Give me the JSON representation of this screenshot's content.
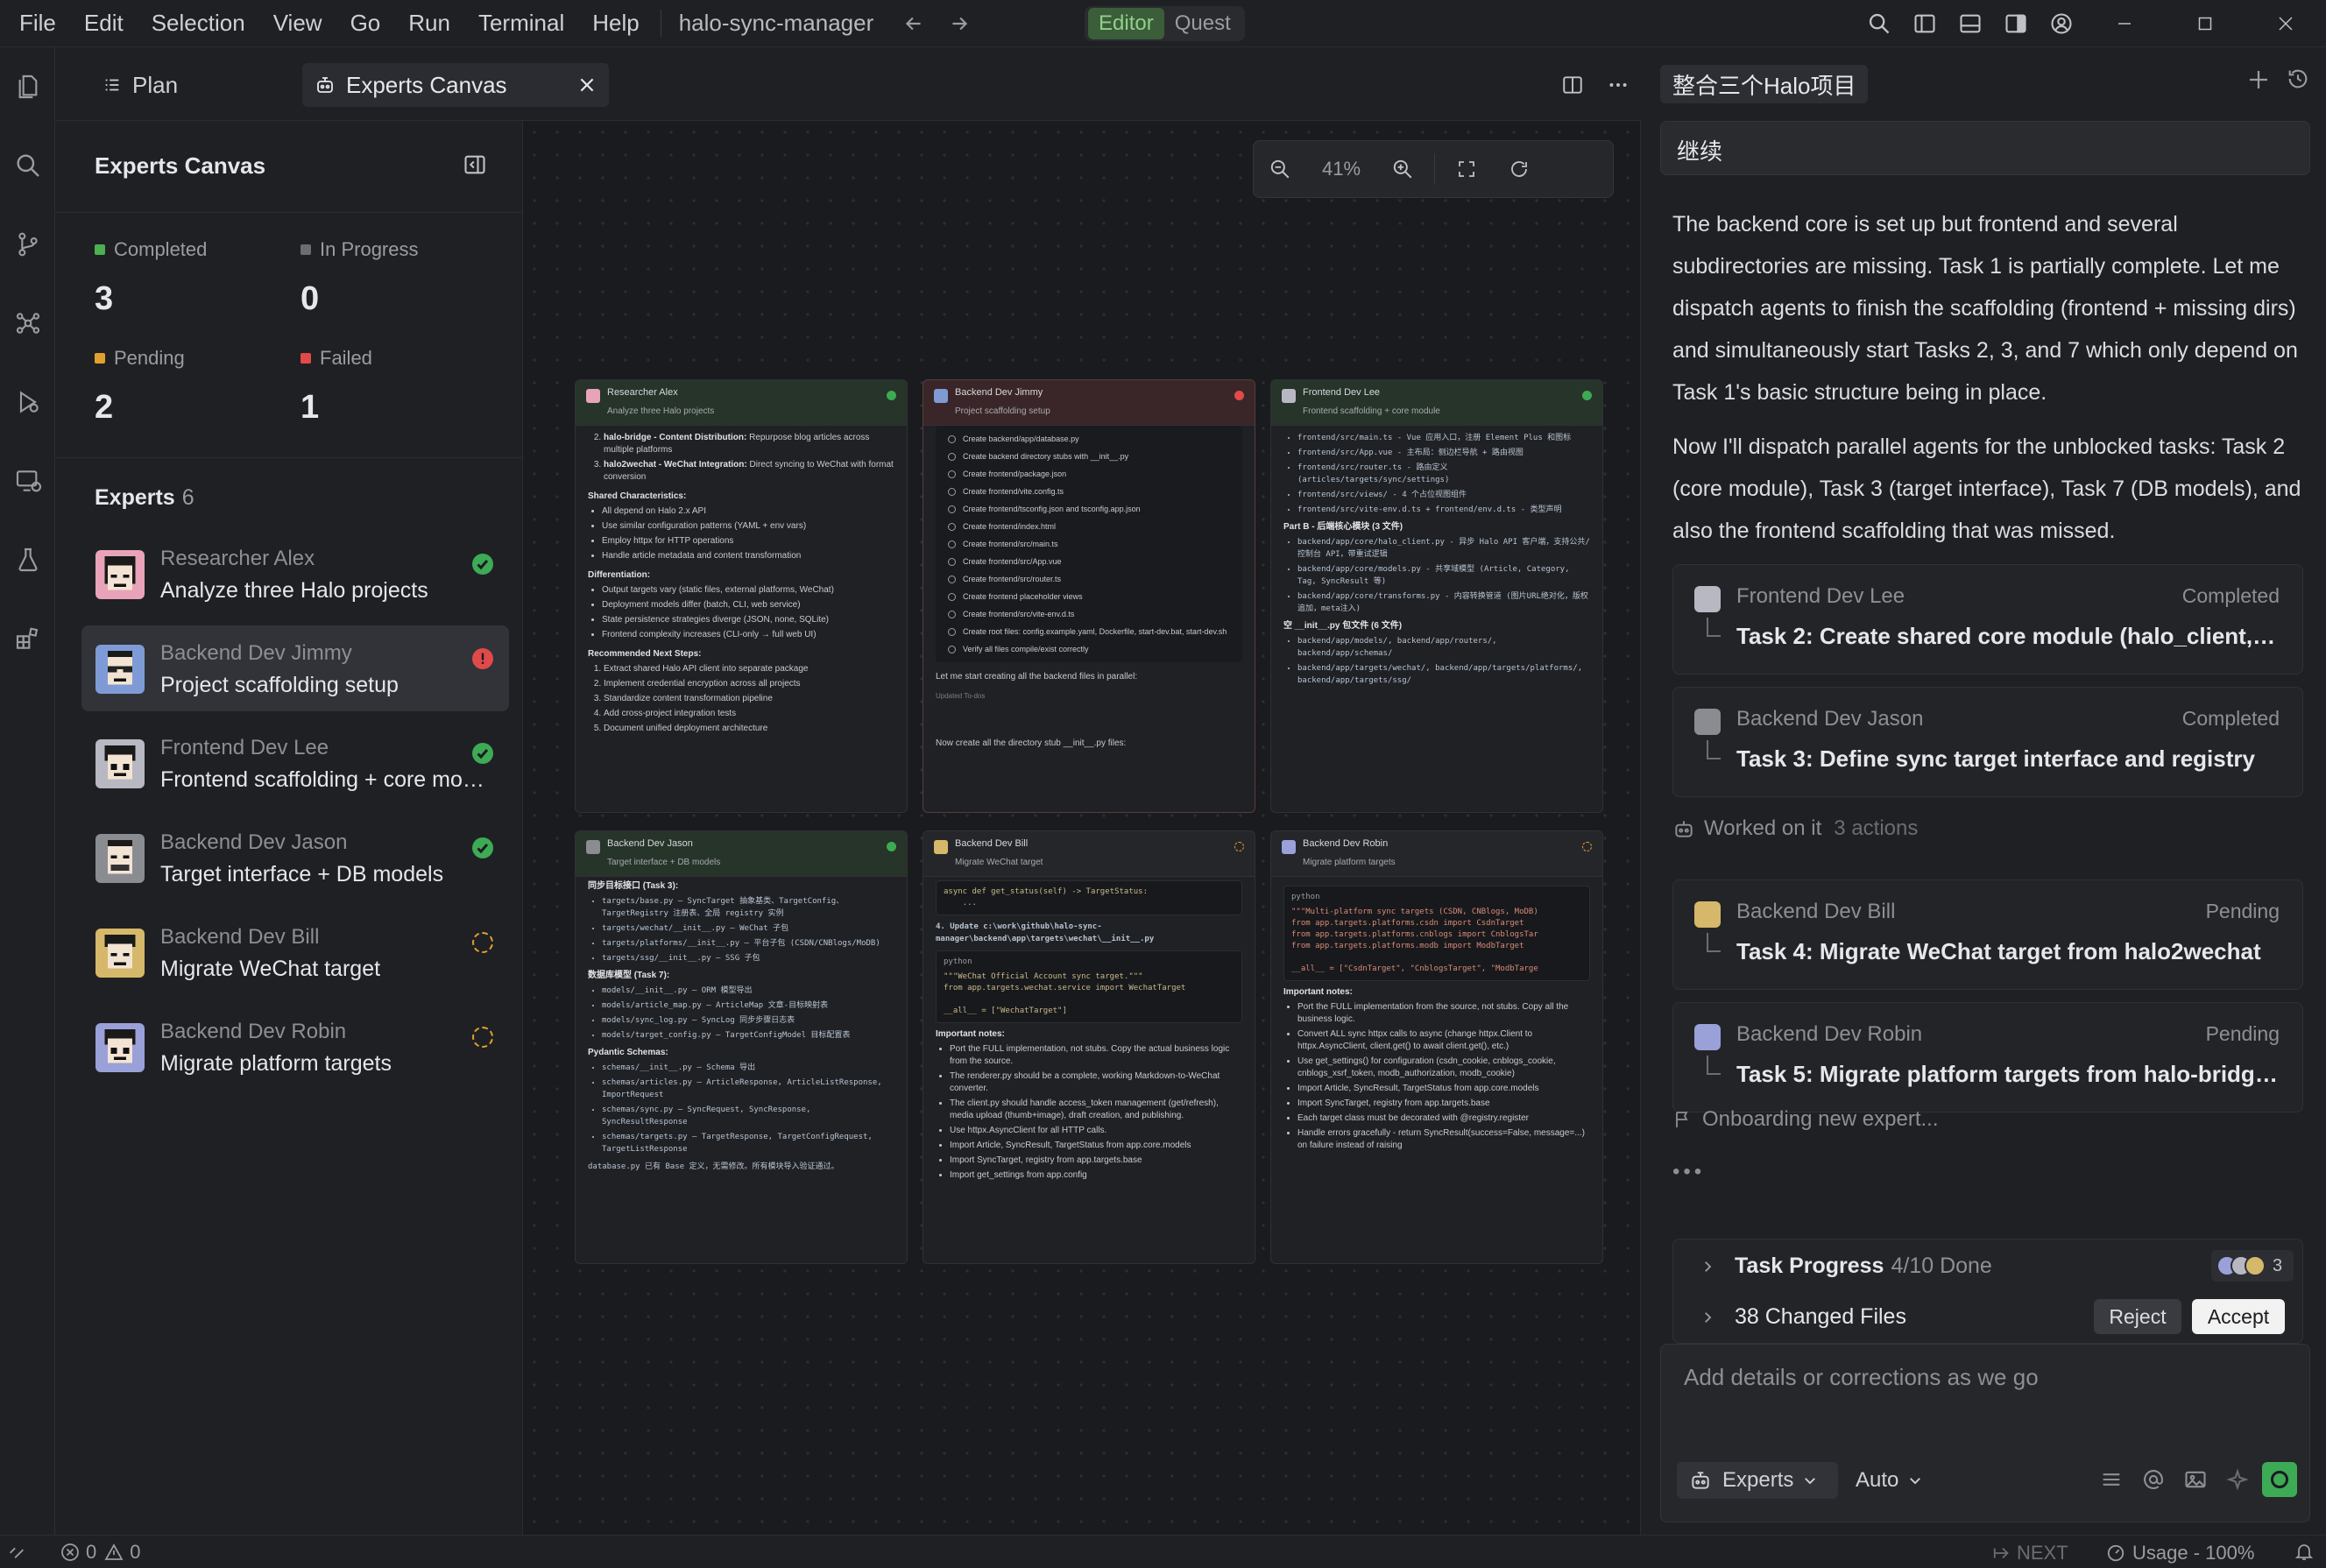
{
  "menu": [
    "File",
    "Edit",
    "Selection",
    "View",
    "Go",
    "Run",
    "Terminal",
    "Help"
  ],
  "project_name": "halo-sync-manager",
  "mode": {
    "active": "Editor",
    "inactive": "Quest"
  },
  "tabs": {
    "plan": "Plan",
    "canvas": "Experts Canvas"
  },
  "panel": {
    "title": "Experts Canvas",
    "stats": [
      {
        "label": "Completed",
        "value": "3",
        "color": "#4caf50"
      },
      {
        "label": "In Progress",
        "value": "0",
        "color": "#8d8f95"
      },
      {
        "label": "Pending",
        "value": "2",
        "color": "#e0a030"
      },
      {
        "label": "Failed",
        "value": "1",
        "color": "#e04a4a"
      }
    ],
    "experts_label": "Experts",
    "experts_count": "6",
    "experts": [
      {
        "name": "Researcher Alex",
        "task": "Analyze three Halo projects",
        "status": "completed"
      },
      {
        "name": "Backend Dev Jimmy",
        "task": "Project scaffolding setup",
        "status": "failed"
      },
      {
        "name": "Frontend Dev Lee",
        "task": "Frontend scaffolding + core modules",
        "status": "completed"
      },
      {
        "name": "Backend Dev Jason",
        "task": "Target interface + DB models",
        "status": "completed"
      },
      {
        "name": "Backend Dev Bill",
        "task": "Migrate WeChat target",
        "status": "pending"
      },
      {
        "name": "Backend Dev Robin",
        "task": "Migrate platform targets",
        "status": "pending"
      }
    ]
  },
  "zoom": "41%",
  "cards": {
    "alex": {
      "name": "Researcher Alex",
      "task": "Analyze three Halo projects",
      "items": [
        {
          "b": "halo-bridge - Content Distribution:",
          "t": " Repurpose blog articles across multiple platforms"
        },
        {
          "b": "halo2wechat - WeChat Integration:",
          "t": " Direct syncing to WeChat with format conversion"
        }
      ],
      "shared_title": "Shared Characteristics:",
      "shared": [
        "All depend on Halo 2.x API",
        "Use similar configuration patterns (YAML + env vars)",
        "Employ httpx for HTTP operations",
        "Handle article metadata and content transformation"
      ],
      "diff_title": "Differentiation:",
      "diff": [
        "Output targets vary (static files, external platforms, WeChat)",
        "Deployment models differ (batch, CLI, web service)",
        "State persistence strategies diverge (JSON, none, SQLite)",
        "Frontend complexity increases (CLI-only → full web UI)"
      ],
      "next_title": "Recommended Next Steps:",
      "next": [
        "Extract shared Halo API client into separate package",
        "Implement credential encryption across all projects",
        "Standardize content transformation pipeline",
        "Add cross-project integration tests",
        "Document unified deployment architecture"
      ]
    },
    "jimmy": {
      "name": "Backend Dev Jimmy",
      "task": "Project scaffolding setup",
      "todos": [
        "Create backend/app/database.py",
        "Create backend directory stubs with __init__.py",
        "Create frontend/package.json",
        "Create frontend/vite.config.ts",
        "Create frontend/tsconfig.json and tsconfig.app.json",
        "Create frontend/index.html",
        "Create frontend/src/main.ts",
        "Create frontend/src/App.vue",
        "Create frontend/src/router.ts",
        "Create frontend placeholder views",
        "Create frontend/src/vite-env.d.ts",
        "Create root files: config.example.yaml, Dockerfile, start-dev.bat, start-dev.sh",
        "Verify all files compile/exist correctly"
      ],
      "msg1": "Let me start creating all the backend files in parallel:",
      "updated": "Updated To-dos",
      "msg2": "Now create all the directory stub __init__.py files:"
    },
    "lee": {
      "name": "Frontend Dev Lee",
      "task": "Frontend scaffolding + core module",
      "lines": [
        "frontend/src/main.ts - Vue 应用入口，注册 Element Plus 和图标",
        "frontend/src/App.vue - 主布局：侧边栏导航 + 路由视图",
        "frontend/src/router.ts - 路由定义 (articles/targets/sync/settings)",
        "frontend/src/views/ - 4 个占位视图组件",
        "frontend/src/vite-env.d.ts + frontend/env.d.ts - 类型声明"
      ],
      "partb": "Part B - 后端核心模块 (3 文件)",
      "lines2": [
        "backend/app/core/halo_client.py - 异步 Halo API 客户端，支持公共/控制台 API，带重试逻辑",
        "backend/app/core/models.py - 共享域模型 (Article, Category, Tag, SyncResult 等)",
        "backend/app/core/transforms.py - 内容转换管道 (图片URL绝对化，版权追加，meta注入)"
      ],
      "init": "空 __init__.py 包文件 (6 文件)",
      "lines3": [
        "backend/app/models/, backend/app/routers/, backend/app/schemas/",
        "backend/app/targets/wechat/, backend/app/targets/platforms/, backend/app/targets/ssg/"
      ]
    },
    "jason": {
      "name": "Backend Dev Jason",
      "task": "Target interface + DB models",
      "top": "同步目标接口 (Task 3):",
      "lines": [
        "targets/base.py — SyncTarget 抽象基类、TargetConfig、TargetRegistry 注册表、全局 registry 实例",
        "targets/wechat/__init__.py — WeChat 子包",
        "targets/platforms/__init__.py — 平台子包 (CSDN/CNBlogs/MoDB)",
        "targets/ssg/__init__.py — SSG 子包"
      ],
      "dbtitle": "数据库模型 (Task 7):",
      "db": [
        "models/__init__.py — ORM 模型导出",
        "models/article_map.py — ArticleMap 文章-目标映射表",
        "models/sync_log.py — SyncLog 同步步骤日志表",
        "models/target_config.py — TargetConfigModel 目标配置表"
      ],
      "pyd": "Pydantic Schemas:",
      "schemas": [
        "schemas/__init__.py — Schema 导出",
        "schemas/articles.py — ArticleResponse, ArticleListResponse, ImportRequest",
        "schemas/sync.py — SyncRequest, SyncResponse, SyncResultResponse",
        "schemas/targets.py — TargetResponse, TargetConfigRequest, TargetListResponse"
      ],
      "foot": "database.py 已有 Base 定义，无需修改。所有模块导入验证通过。"
    },
    "bill": {
      "name": "Backend Dev Bill",
      "task": "Migrate WeChat target",
      "code1": "async def get_status(self) -> TargetStatus:\n    ...",
      "update": "4. Update c:\\work\\github\\halo-sync-manager\\backend\\app\\targets\\wechat\\__init__.py",
      "lang": "python",
      "code2": "\"\"\"WeChat Official Account sync target.\"\"\"\nfrom app.targets.wechat.service import WechatTarget\n\n__all__ = [\"WechatTarget\"]",
      "notes_title": "Important notes:",
      "notes": [
        "Port the FULL implementation, not stubs. Copy the actual business logic from the source.",
        "The renderer.py should be a complete, working Markdown-to-WeChat converter.",
        "The client.py should handle access_token management (get/refresh), media upload (thumb+image), draft creation, and publishing.",
        "Use httpx.AsyncClient for all HTTP calls.",
        "Import Article, SyncResult, TargetStatus from app.core.models",
        "Import SyncTarget, registry from app.targets.base",
        "Import get_settings from app.config"
      ]
    },
    "robin": {
      "name": "Backend Dev Robin",
      "task": "Migrate platform targets",
      "lang": "python",
      "code": "\"\"\"Multi-platform sync targets (CSDN, CNBlogs, MoDB)\nfrom app.targets.platforms.csdn import CsdnTarget\nfrom app.targets.platforms.cnblogs import CnblogsTar\nfrom app.targets.platforms.modb import ModbTarget\n\n__all__ = [\"CsdnTarget\", \"CnblogsTarget\", \"ModbTarge",
      "notes_title": "Important notes:",
      "notes": [
        "Port the FULL implementation from the source, not stubs. Copy all the business logic.",
        "Convert ALL sync httpx calls to async (change httpx.Client to httpx.AsyncClient, client.get() to await client.get(), etc.)",
        "Use get_settings() for configuration (csdn_cookie, cnblogs_cookie, cnblogs_xsrf_token, modb_authorization, modb_cookie)",
        "Import Article, SyncResult, TargetStatus from app.core.models",
        "Import SyncTarget, registry from app.targets.base",
        "Each target class must be decorated with @registry.register",
        "Handle errors gracefully - return SyncResult(success=False, message=...) on failure instead of raising"
      ]
    }
  },
  "right": {
    "title": "整合三个Halo项目",
    "user_msg": "继续",
    "para1": "The backend core is set up but frontend and several subdirectories are missing. Task 1 is partially complete. Let me dispatch agents to finish the scaffolding (frontend + missing dirs) and simultaneously start Tasks 2, 3, and 7 which only depend on Task 1's basic structure being in place.",
    "para2": "Now I'll dispatch parallel agents for the unblocked tasks: Task 2 (core module), Task 3 (target interface), Task 7 (DB models), and also the frontend scaffolding that was missed.",
    "tasks": [
      {
        "name": "Frontend Dev Lee",
        "status": "Completed",
        "title": "Task 2: Create shared core module (halo_client, models, transforms)"
      },
      {
        "name": "Backend Dev Jason",
        "status": "Completed",
        "title": "Task 3: Define sync target interface and registry"
      },
      {
        "name": "Backend Dev Bill",
        "status": "Pending",
        "title": "Task 4: Migrate WeChat target from halo2wechat"
      },
      {
        "name": "Backend Dev Robin",
        "status": "Pending",
        "title": "Task 5: Migrate platform targets from halo-bridge (CSDN, CNBlogs, MoDB)"
      }
    ],
    "worked_on": "Worked on it",
    "worked_actions": "3 actions",
    "onboarding": "Onboarding new expert...",
    "ellipsis": "•••",
    "task_progress": "Task Progress",
    "task_progress_val": "4/10 Done",
    "changed_files": "38 Changed Files",
    "reject": "Reject",
    "accept": "Accept",
    "avatar_count": "3",
    "input_placeholder": "Add details or corrections as we go",
    "experts_btn": "Experts",
    "auto_btn": "Auto"
  },
  "status": {
    "errors": "0",
    "warnings": "0",
    "next": "NEXT",
    "usage": "Usage - 100%"
  }
}
